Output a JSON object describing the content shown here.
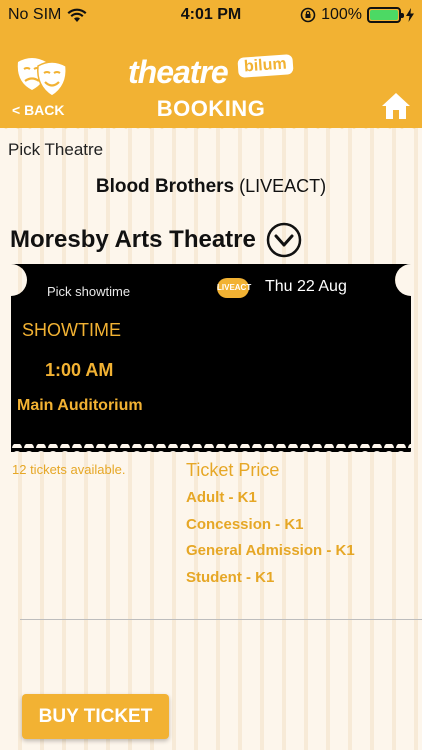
{
  "status": {
    "carrier": "No SIM",
    "time": "4:01 PM",
    "battery": "100%",
    "battery_level": 1.0
  },
  "header": {
    "back_label": "< BACK",
    "brand_word": "theatre",
    "brand_tag": "bilum",
    "title": "BOOKING"
  },
  "pick_theatre_label": "Pick Theatre",
  "show": {
    "name": "Blood Brothers",
    "type": "(LIVEACT)"
  },
  "theatre": {
    "name": "Moresby Arts Theatre"
  },
  "ticket": {
    "pick_showtime_label": "Pick showtime",
    "badge_text": "LIVEACT",
    "date": "Thu 22 Aug",
    "showtime_label": "SHOWTIME",
    "time": "1:00 AM",
    "venue": "Main Auditorium"
  },
  "availability": "12 tickets available.",
  "pricing": {
    "title": "Ticket Price",
    "items": [
      "Adult - K1",
      "Concession - K1",
      "General Admission - K1",
      "Student - K1"
    ]
  },
  "buy_label": "BUY TICKET",
  "colors": {
    "accent": "#f2b233",
    "ticket_bg": "#000000",
    "battery": "#4cd964"
  }
}
